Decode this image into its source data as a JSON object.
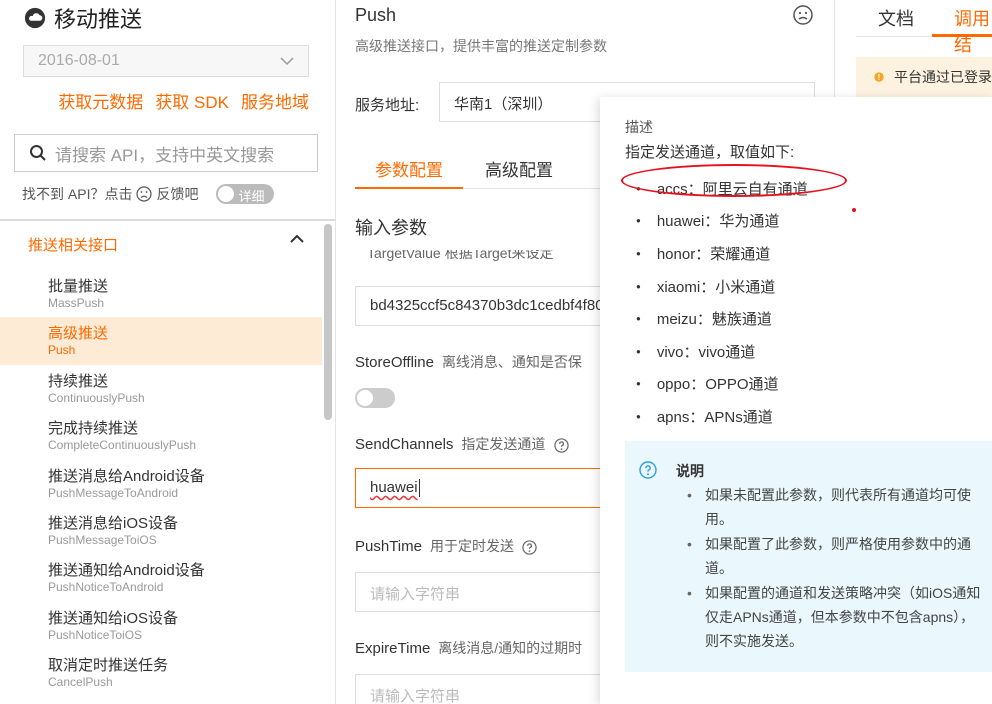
{
  "sidebar": {
    "brand_title": "移动推送",
    "date_value": "2016-08-01",
    "links": [
      "获取元数据",
      "获取 SDK",
      "服务地域"
    ],
    "search_placeholder": "请搜索 API，支持中英文搜索",
    "feedback_text": "找不到 API？点击",
    "feedback_link": "反馈吧",
    "detail_toggle": "详细",
    "group_title": "推送相关接口",
    "items": [
      {
        "cn": "批量推送",
        "en": "MassPush"
      },
      {
        "cn": "高级推送",
        "en": "Push"
      },
      {
        "cn": "持续推送",
        "en": "ContinuouslyPush"
      },
      {
        "cn": "完成持续推送",
        "en": "CompleteContinuouslyPush"
      },
      {
        "cn": "推送消息给Android设备",
        "en": "PushMessageToAndroid"
      },
      {
        "cn": "推送消息给iOS设备",
        "en": "PushMessageToiOS"
      },
      {
        "cn": "推送通知给Android设备",
        "en": "PushNoticeToAndroid"
      },
      {
        "cn": "推送通知给iOS设备",
        "en": "PushNoticeToiOS"
      },
      {
        "cn": "取消定时推送任务",
        "en": "CancelPush"
      }
    ]
  },
  "main": {
    "api_title": "Push",
    "api_subtitle": "高级推送接口，提供丰富的推送定制参数",
    "service_label": "服务地址:",
    "service_value": "华南1（深圳）",
    "tab_params": "参数配置",
    "tab_advanced": "高级配置",
    "input_params_heading": "输入参数",
    "target_value_label_cut": "TargetValue  根据Target来设定",
    "target_value": "bd4325ccf5c84370b3dc1cedbf4f80",
    "store_offline_label": "StoreOffline",
    "store_offline_desc": "离线消息、通知是否保",
    "send_channels_label": "SendChannels",
    "send_channels_desc": "指定发送通道",
    "send_channels_value": "huawei",
    "push_time_label": "PushTime",
    "push_time_desc": "用于定时发送",
    "push_time_placeholder": "请输入字符串",
    "expire_time_label": "ExpireTime",
    "expire_time_desc": "离线消息/通知的过期时",
    "expire_time_placeholder": "请输入字符串"
  },
  "right": {
    "tab_docs": "文档",
    "tab_debug": "调用结",
    "warning_text": "平台通过已登录"
  },
  "popover": {
    "title": "描述",
    "subtitle": "指定发送通道，取值如下:",
    "channels": [
      "accs：阿里云自有通道",
      "huawei：华为通道",
      "honor：荣耀通道",
      "xiaomi：小米通道",
      "meizu：魅族通道",
      "vivo：vivo通道",
      "oppo：OPPO通道",
      "apns：APNs通道"
    ],
    "note_heading": "说明",
    "notes": [
      "如果未配置此参数，则代表所有通道均可使用。",
      "如果配置了此参数，则严格使用参数中的通道。",
      "如果配置的通道和发送策略冲突（如iOS通知仅走APNs通道，但本参数中不包含apns），则不实施发送。"
    ]
  },
  "colors": {
    "accent": "#ff6a00",
    "highlight_oval": "#e8101d",
    "note_bg": "#eaf7fd",
    "active_item_bg": "#fdebd6"
  }
}
